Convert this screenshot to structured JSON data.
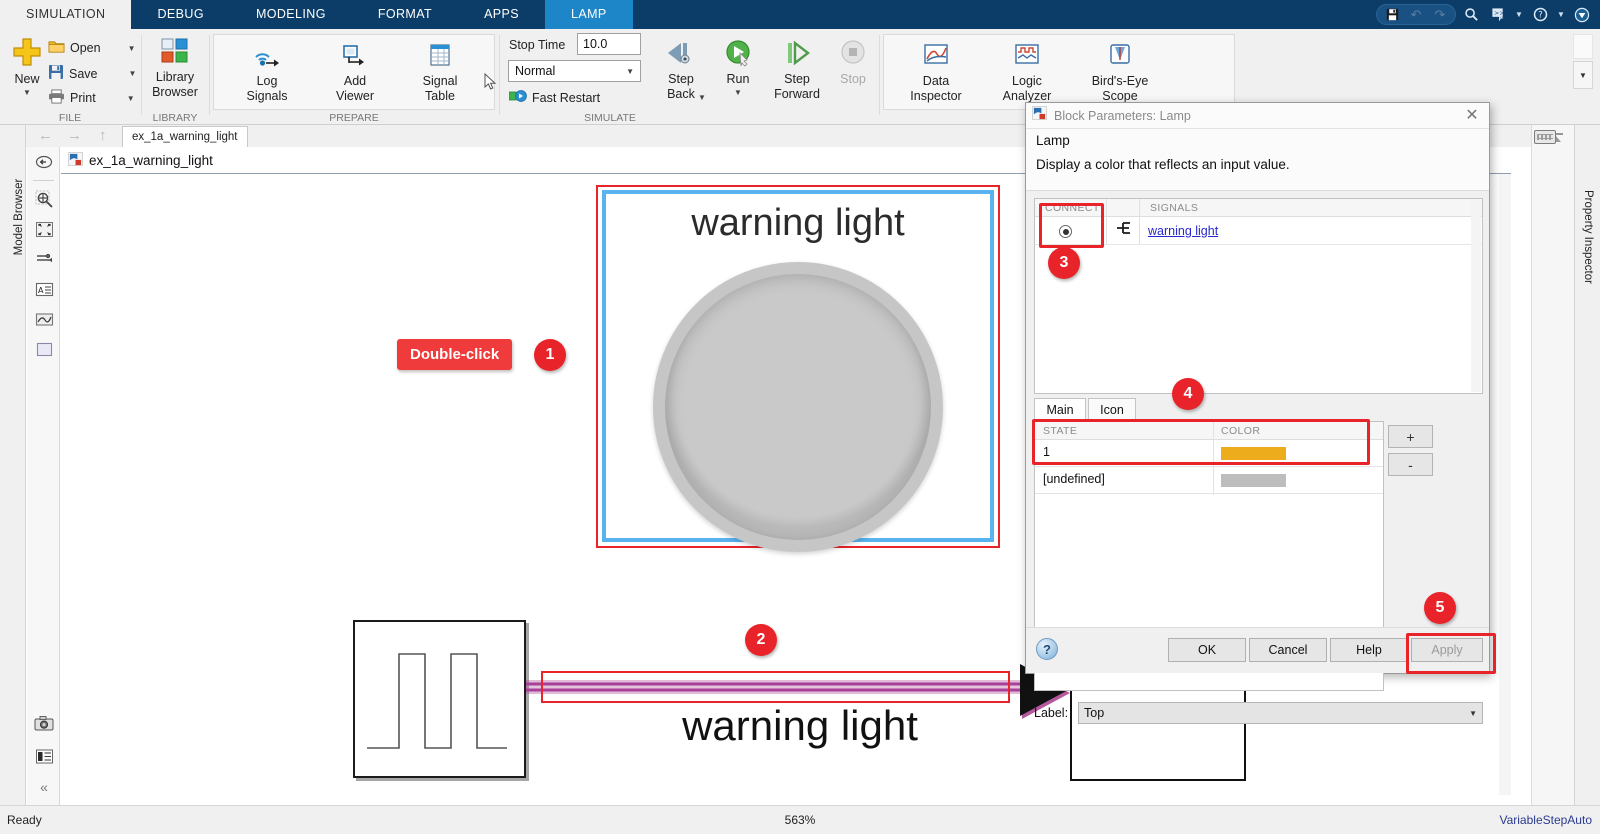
{
  "titlebar": {
    "tabs": [
      {
        "label": "SIMULATION",
        "state": "active-white"
      },
      {
        "label": "DEBUG",
        "state": "normal"
      },
      {
        "label": "MODELING",
        "state": "normal"
      },
      {
        "label": "FORMAT",
        "state": "normal"
      },
      {
        "label": "APPS",
        "state": "normal"
      },
      {
        "label": "LAMP",
        "state": "active-light"
      }
    ],
    "icons": [
      "save-icon",
      "undo-icon",
      "redo-icon",
      "search-icon",
      "quick-access-icon",
      "help-icon",
      "user-icon"
    ]
  },
  "ribbon": {
    "groups": [
      {
        "name": "FILE"
      },
      {
        "name": "LIBRARY"
      },
      {
        "name": "PREPARE"
      },
      {
        "name": "SIMULATE"
      }
    ],
    "file": {
      "new": "New",
      "open": "Open",
      "save": "Save",
      "print": "Print"
    },
    "library": {
      "line1": "Library",
      "line2": "Browser"
    },
    "prepare": {
      "log_signals_1": "Log",
      "log_signals_2": "Signals",
      "add_viewer_1": "Add",
      "add_viewer_2": "Viewer",
      "signal_table_1": "Signal",
      "signal_table_2": "Table"
    },
    "simulate": {
      "stop_time_label": "Stop Time",
      "stop_time_value": "10.0",
      "mode_value": "Normal",
      "fast_restart": "Fast Restart",
      "step_back_1": "Step",
      "step_back_2": "Back",
      "run": "Run",
      "step_forward_1": "Step",
      "step_forward_2": "Forward",
      "stop": "Stop"
    },
    "review": {
      "data_inspector_1": "Data",
      "data_inspector_2": "Inspector",
      "logic_analyzer_1": "Logic",
      "logic_analyzer_2": "Analyzer",
      "birds_eye_1": "Bird's-Eye",
      "birds_eye_2": "Scope"
    }
  },
  "sidebar": {
    "model_browser": "Model Browser",
    "property_inspector": "Property Inspector"
  },
  "file_tab": {
    "label": "ex_1a_warning_light"
  },
  "breadcrumb": {
    "model": "ex_1a_warning_light"
  },
  "canvas": {
    "lamp_block": {
      "title": "warning light"
    },
    "signal_label": "warning light",
    "annotations": [
      {
        "id": "1",
        "badge": "1",
        "pill": "Double-click"
      },
      {
        "id": "2",
        "badge": "2"
      },
      {
        "id": "3",
        "badge": "3"
      },
      {
        "id": "4",
        "badge": "4"
      },
      {
        "id": "5",
        "badge": "5"
      }
    ]
  },
  "dialog": {
    "title": "Block Parameters: Lamp",
    "heading": "Lamp",
    "description": "Display a color that reflects an input value.",
    "signals_table": {
      "headers": [
        "CONNECT",
        "SIGNALS"
      ],
      "rows": [
        {
          "connected": true,
          "signal": "warning light"
        }
      ]
    },
    "tabs": [
      {
        "label": "Main",
        "selected": true
      },
      {
        "label": "Icon",
        "selected": false
      }
    ],
    "state_table": {
      "headers": [
        "STATE",
        "COLOR"
      ],
      "rows": [
        {
          "state": "1",
          "color": "#ecac1b"
        },
        {
          "state": "[undefined]",
          "color": "#bdbdbd"
        }
      ]
    },
    "add_button": "+",
    "remove_button": "-",
    "label_caption": "Label:",
    "label_value": "Top",
    "buttons": {
      "ok": "OK",
      "cancel": "Cancel",
      "help": "Help",
      "apply": "Apply"
    }
  },
  "statusbar": {
    "ready": "Ready",
    "zoom": "563%",
    "solver": "VariableStepAuto"
  },
  "colors": {
    "ribbon_blue": "#0b3d68",
    "active_tab_blue": "#1d86c8",
    "annotation_red": "#e8242a",
    "selection_blue": "#59b3ef",
    "signal_magenta": "#a8409a",
    "state_color_1": "#ecac1b",
    "state_color_undefined": "#bdbdbd",
    "link_blue": "#2727d0",
    "solver_text": "#2b3a8f"
  }
}
